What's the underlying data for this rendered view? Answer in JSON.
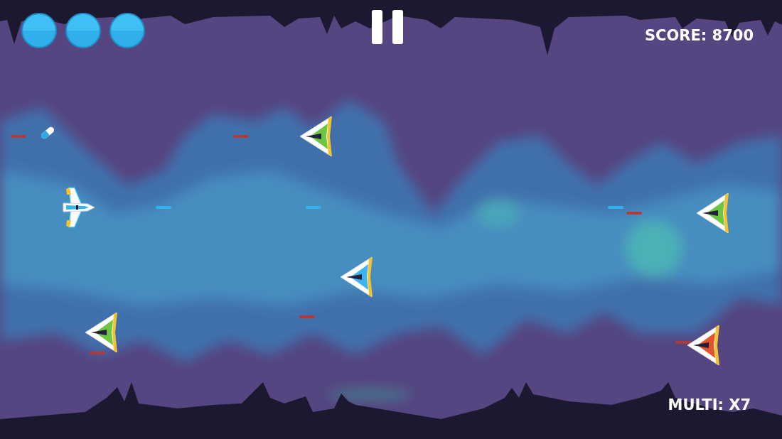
{
  "hud": {
    "lives": [
      {
        "filled": true
      },
      {
        "filled": true
      },
      {
        "filled": true
      }
    ],
    "score": "SCORE: 8700",
    "multiplier": "MULTI: X7"
  },
  "ships": [
    {
      "kind": "player",
      "color": "#35b5ee"
    },
    {
      "kind": "enemy",
      "color": "#6cc644"
    },
    {
      "kind": "enemy",
      "color": "#3bb4f0"
    },
    {
      "kind": "enemy",
      "color": "#6cc644"
    },
    {
      "kind": "enemy",
      "color": "#6cc644"
    },
    {
      "kind": "enemy",
      "color": "#e0552b"
    }
  ],
  "projectiles": [
    {
      "owner": "enemy",
      "color": "#b03a3a"
    },
    {
      "owner": "enemy",
      "color": "#b03a3a"
    },
    {
      "owner": "player",
      "color": "#2fb3ee"
    },
    {
      "owner": "player",
      "color": "#2fb3ee"
    },
    {
      "owner": "player",
      "color": "#2fb3ee"
    },
    {
      "owner": "enemy",
      "color": "#b03a3a"
    },
    {
      "owner": "enemy",
      "color": "#b03a3a"
    },
    {
      "owner": "enemy",
      "color": "#b03a3a"
    },
    {
      "owner": "enemy",
      "color": "#b03a3a"
    }
  ],
  "pickups": [
    {
      "kind": "capsule"
    }
  ]
}
